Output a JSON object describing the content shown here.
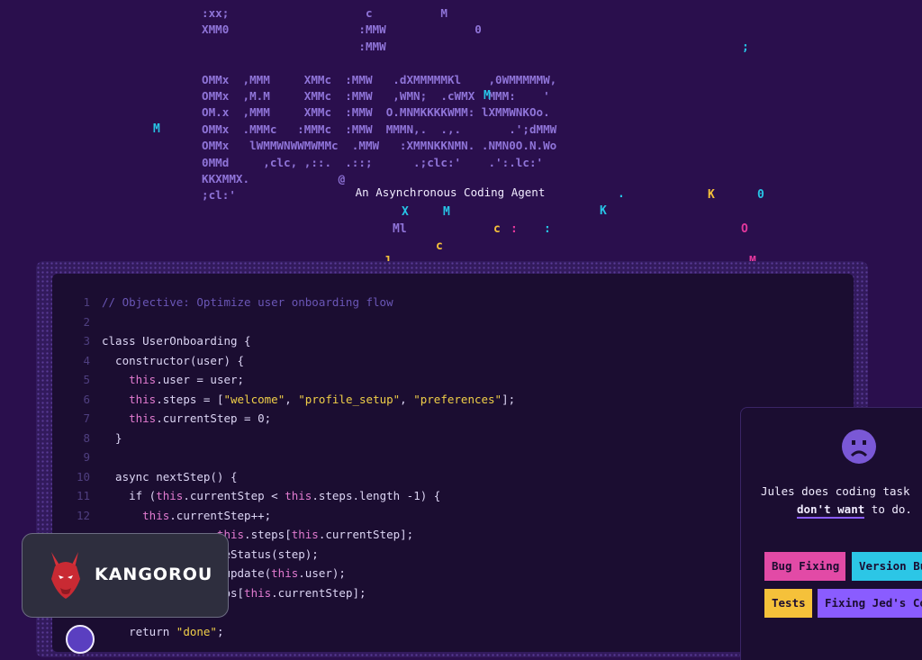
{
  "hero": {
    "ascii_art": ":xx;                    c          M\nXMM0                   :MMW             0\n                       :MMW\n\nOMMx  ,MMM     XMMc  :MMW   .dXMMMMMKl    ,0WMMMMMW,\nOMMx  ,M.M     XMMc  :MMW   ,WMN;  .cWMX  MMM:    '\nOM.x  ,MMM     XMMc  :MMW  O.MNMKKKKWMM: lXMMWNKOo.\nOMMx  .MMMc   :MMMc  :MMW  MMMN,.  .,.       .';dMMW\nOMMx   lWMMWNWWMWMMc  .MMW   :XMMNKKNMN. .NMN0O.N.Wo\n0MMd     ,clc, ,::.  .::;      .;clc:'    .':.lc:'\nKKXMMX.             @\n;cl:'",
    "glyphs": [
      {
        "char": "M",
        "color": "cyan"
      },
      {
        "char": ";",
        "color": "cyan"
      },
      {
        "char": ".",
        "color": "cyan"
      },
      {
        "char": "K",
        "color": "yellow"
      },
      {
        "char": "0",
        "color": "cyan"
      },
      {
        "char": "X",
        "color": "cyan"
      },
      {
        "char": "M",
        "color": "cyan"
      },
      {
        "char": "K",
        "color": "cyan"
      },
      {
        "char": "Ml",
        "color": "purple"
      },
      {
        "char": "c",
        "color": "yellow"
      },
      {
        "char": ":",
        "color": "pink"
      },
      {
        "char": ":",
        "color": "cyan"
      },
      {
        "char": "O",
        "color": "pink"
      },
      {
        "char": "c",
        "color": "yellow"
      },
      {
        "char": "l",
        "color": "yellow"
      },
      {
        "char": "M",
        "color": "pink"
      },
      {
        "char": "M",
        "color": "cyan"
      }
    ],
    "tagline": "An Asynchronous Coding Agent"
  },
  "code": {
    "lines": [
      {
        "n": "1",
        "text": "// Objective: Optimize user onboarding flow",
        "kind": "comment"
      },
      {
        "n": "2",
        "text": ""
      },
      {
        "n": "3",
        "text": "class UserOnboarding {"
      },
      {
        "n": "4",
        "text": "  constructor(user) {"
      },
      {
        "n": "5",
        "text": "    this.user = user;"
      },
      {
        "n": "6",
        "text": "    this.steps = [\"welcome\", \"profile_setup\", \"preferences\"];"
      },
      {
        "n": "7",
        "text": "    this.currentStep = 0;"
      },
      {
        "n": "8",
        "text": "  }"
      },
      {
        "n": "9",
        "text": ""
      },
      {
        "n": "10",
        "text": "  async nextStep() {"
      },
      {
        "n": "11",
        "text": "    if (this.currentStep < this.steps.length -1) {"
      },
      {
        "n": "12",
        "text": "      this.currentStep++;"
      },
      {
        "n": "",
        "text": "                 this.steps[this.currentStep];"
      },
      {
        "n": "",
        "text": "                ateStatus(step);"
      },
      {
        "n": "",
        "text": "                s.update(this.user);"
      },
      {
        "n": "",
        "text": "                teps[this.currentStep];"
      },
      {
        "n": "",
        "text": ""
      },
      {
        "n": "",
        "text": "    return \"done\";"
      }
    ]
  },
  "feedback": {
    "icon": "sad-face-icon",
    "line1": "Jules does coding task",
    "emphasis": "don't want",
    "line2_rest": " to do.",
    "chips": [
      {
        "label": "Bug Fixing",
        "color": "#e24aa6"
      },
      {
        "label": "Version Bu",
        "color": "#2cc6e6"
      },
      {
        "label": "Tests",
        "color": "#f5c13a"
      },
      {
        "label": "Fixing Jed's Co",
        "color": "#8a5cff"
      }
    ]
  },
  "watermark": {
    "brand": "KANGOROU"
  },
  "colors": {
    "background": "#2a0f4d",
    "panel": "#1b0d31",
    "yellow": "#f5c13a",
    "pink": "#e2379c",
    "cyan": "#27c4e6",
    "purple": "#8f74d8"
  }
}
